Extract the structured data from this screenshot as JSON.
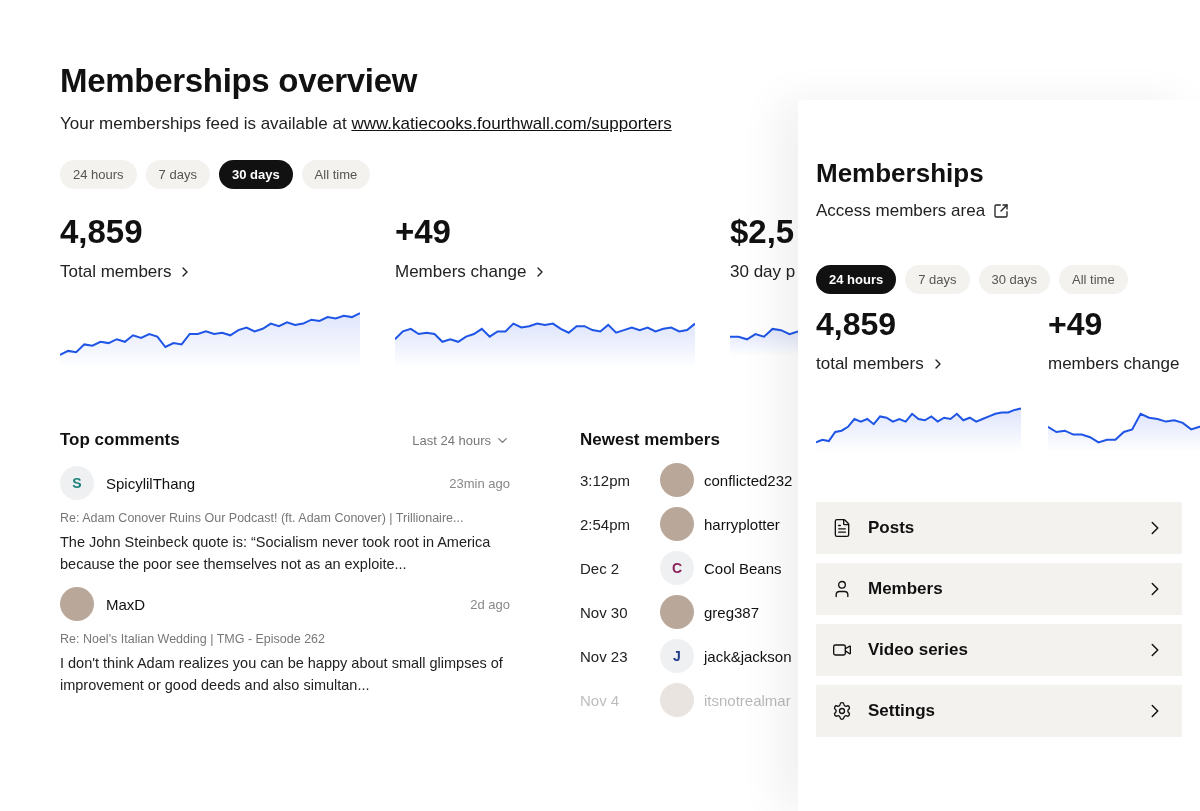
{
  "overview": {
    "title": "Memberships overview",
    "feed_text": "Your memberships feed is available at",
    "feed_link": "www.katiecooks.fourthwall.com/supporters",
    "ranges": [
      {
        "label": "24 hours",
        "selected": false
      },
      {
        "label": "7 days",
        "selected": false
      },
      {
        "label": "30 days",
        "selected": true
      },
      {
        "label": "All time",
        "selected": false
      }
    ],
    "stats": [
      {
        "value": "4,859",
        "label": "Total members",
        "chevron": true
      },
      {
        "value": "+49",
        "label": "Members change",
        "chevron": true
      },
      {
        "value": "$2,5",
        "label": "30 day p",
        "chevron": false
      }
    ],
    "top_comments": {
      "title": "Top comments",
      "filter": "Last 24 hours",
      "comments": [
        {
          "kind": "letter",
          "initial": "S",
          "color": "#1b7f7a",
          "author": "SpicylilThang",
          "time": "23min ago",
          "context": "Re: Adam Conover Ruins Our Podcast! (ft. Adam Conover) | Trillionaire...",
          "body": "The John Steinbeck quote is: “Socialism never took root in America because the poor see themselves not as an exploite..."
        },
        {
          "kind": "photo",
          "author": "MaxD",
          "time": "2d ago",
          "context": "Re: Noel's Italian Wedding | TMG - Episode 262",
          "body": "I don't think Adam realizes you can be happy about small glimpses of improvement or good deeds and also simultan..."
        }
      ]
    },
    "newest_members": {
      "title": "Newest members",
      "members": [
        {
          "time": "3:12pm",
          "kind": "photo",
          "name": "conflicted232",
          "faded": false
        },
        {
          "time": "2:54pm",
          "kind": "photo",
          "name": "harryplotter",
          "faded": false
        },
        {
          "time": "Dec 2",
          "kind": "letter",
          "initial": "C",
          "color": "#8a1f5c",
          "name": "Cool Beans",
          "faded": false
        },
        {
          "time": "Nov 30",
          "kind": "photo",
          "name": "greg387",
          "faded": false
        },
        {
          "time": "Nov 23",
          "kind": "letter",
          "initial": "J",
          "color": "#1f3a8a",
          "name": "jack&jackson",
          "faded": false
        },
        {
          "time": "Nov 4",
          "kind": "photo",
          "name": "itsnotrealmar",
          "faded": true
        }
      ]
    }
  },
  "mobile": {
    "title": "Memberships",
    "link": "Access members area",
    "ranges": [
      {
        "label": "24 hours",
        "selected": true
      },
      {
        "label": "7 days",
        "selected": false
      },
      {
        "label": "30 days",
        "selected": false
      },
      {
        "label": "All time",
        "selected": false
      }
    ],
    "stats": [
      {
        "value": "4,859",
        "label": "total members",
        "chevron": true
      },
      {
        "value": "+49",
        "label": "members change",
        "chevron": false
      }
    ],
    "menu": [
      {
        "label": "Posts",
        "kind": "document"
      },
      {
        "label": "Members",
        "kind": "person"
      },
      {
        "label": "Video series",
        "kind": "video"
      },
      {
        "label": "Settings",
        "kind": "gear"
      }
    ]
  }
}
